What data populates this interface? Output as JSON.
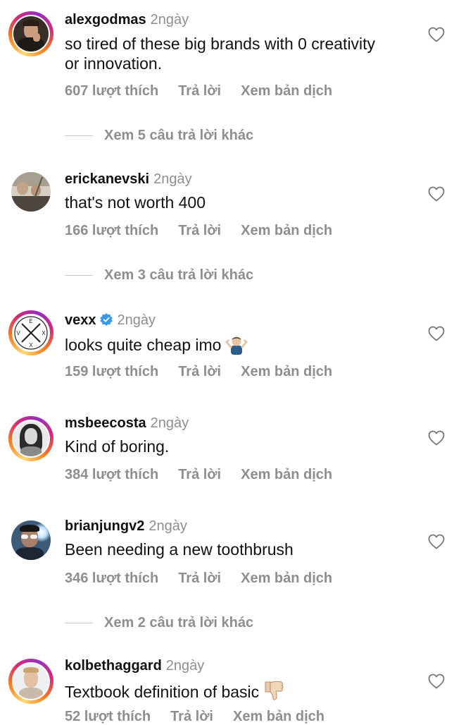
{
  "comments": [
    {
      "username": "alexgodmas",
      "time": "2ngày",
      "text": "so tired of these big brands with 0 creativity or innovation.",
      "likes": "607 lượt thích",
      "reply": "Trả lời",
      "translate": "Xem bản dịch",
      "more_replies": "Xem 5 câu trả lời khác"
    },
    {
      "username": "erickanevski",
      "time": "2ngày",
      "text": "that's not worth 400",
      "likes": "166 lượt thích",
      "reply": "Trả lời",
      "translate": "Xem bản dịch",
      "more_replies": "Xem 3 câu trả lời khác"
    },
    {
      "username": "vexx",
      "time": "2ngày",
      "text": "looks quite cheap imo",
      "likes": "159 lượt thích",
      "reply": "Trả lời",
      "translate": "Xem bản dịch",
      "avatar_letters": [
        "E",
        "V",
        "X",
        "X"
      ]
    },
    {
      "username": "msbeecosta",
      "time": "2ngày",
      "text": "Kind of boring.",
      "likes": "384 lượt thích",
      "reply": "Trả lời",
      "translate": "Xem bản dịch"
    },
    {
      "username": "brianjungv2",
      "time": "2ngày",
      "text": "Been needing a new toothbrush",
      "likes": "346 lượt thích",
      "reply": "Trả lời",
      "translate": "Xem bản dịch",
      "more_replies": "Xem 2 câu trả lời khác"
    },
    {
      "username": "kolbethaggard",
      "time": "2ngày",
      "text": "Textbook definition of basic",
      "likes": "52 lượt thích",
      "reply": "Trả lời",
      "translate": "Xem bản dịch"
    }
  ],
  "icons": {
    "like": "heart-outline-icon",
    "verified": "verified-badge-icon",
    "shrug": "person-shrugging-emoji",
    "thumbs_down": "thumbs-down-emoji"
  },
  "colors": {
    "secondary_text": "#8e8e8e",
    "verified_blue": "#3897f0",
    "story_ring_start": "#feda75",
    "story_ring_end": "#962fbf"
  }
}
